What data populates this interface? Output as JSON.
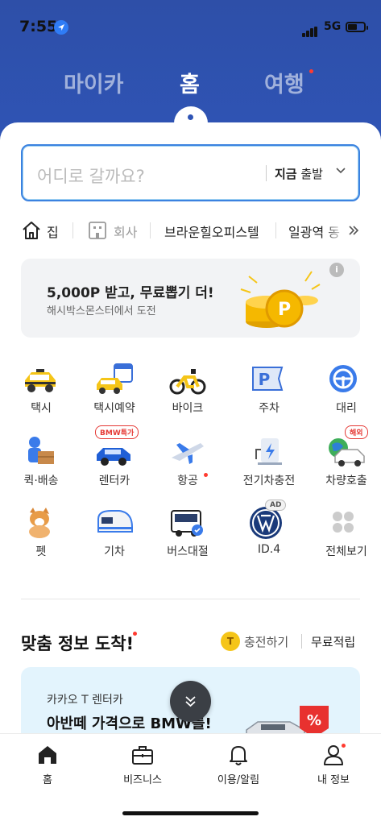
{
  "status": {
    "time": "7:55",
    "network": "5G"
  },
  "top_tabs": [
    {
      "label": "마이카",
      "active": false,
      "dot": false
    },
    {
      "label": "홈",
      "active": true,
      "dot": false
    },
    {
      "label": "여행",
      "active": false,
      "dot": true
    }
  ],
  "search": {
    "placeholder": "어디로 갈까요?",
    "when_bold": "지금",
    "when_text": " 출발"
  },
  "places": [
    {
      "label": "집",
      "icon": "home-icon"
    },
    {
      "label": "회사",
      "icon": "building-icon"
    },
    {
      "label": "브라운힐오피스텔"
    },
    {
      "label": "일광역 동"
    }
  ],
  "banner": {
    "title": "5,000P 받고, 무료뽑기 더!",
    "subtitle": "해시박스몬스터에서 도전",
    "info": "i"
  },
  "services": [
    {
      "label": "택시",
      "icon": "taxi-icon"
    },
    {
      "label": "택시예약",
      "icon": "taxi-reservation-icon"
    },
    {
      "label": "바이크",
      "icon": "bike-icon"
    },
    {
      "label": "주차",
      "icon": "parking-icon"
    },
    {
      "label": "대리",
      "icon": "designated-driver-icon"
    },
    {
      "label": "퀵·배송",
      "icon": "delivery-icon"
    },
    {
      "label": "렌터카",
      "icon": "rental-car-icon",
      "badge": "BMW특가"
    },
    {
      "label": "항공",
      "icon": "airplane-icon",
      "dot": true
    },
    {
      "label": "전기차충전",
      "icon": "ev-charging-icon"
    },
    {
      "label": "차량호출",
      "icon": "car-hailing-icon",
      "badge": "해외"
    },
    {
      "label": "펫",
      "icon": "pet-icon"
    },
    {
      "label": "기차",
      "icon": "train-icon"
    },
    {
      "label": "버스대절",
      "icon": "bus-charter-icon"
    },
    {
      "label": "ID.4",
      "icon": "vw-logo-icon",
      "badge": "AD"
    },
    {
      "label": "전체보기",
      "icon": "view-all-icon"
    }
  ],
  "section": {
    "title": "맞춤 정보 도착!",
    "coin": "T",
    "charge": "충전하기",
    "free": "무료적립"
  },
  "promo": {
    "subtitle": "카카오 T 렌터카",
    "title": "아반떼 가격으로 BMW를!",
    "badge": "%"
  },
  "bottom_tabs": [
    {
      "label": "홈",
      "icon": "home-filled-icon"
    },
    {
      "label": "비즈니스",
      "icon": "briefcase-icon"
    },
    {
      "label": "이용/알림",
      "icon": "bell-icon"
    },
    {
      "label": "내 정보",
      "icon": "person-icon",
      "dot": true
    }
  ],
  "colors": {
    "brand_blue": "#2f54b5",
    "accent_red": "#ff3b30",
    "search_border": "#3b82e0"
  }
}
